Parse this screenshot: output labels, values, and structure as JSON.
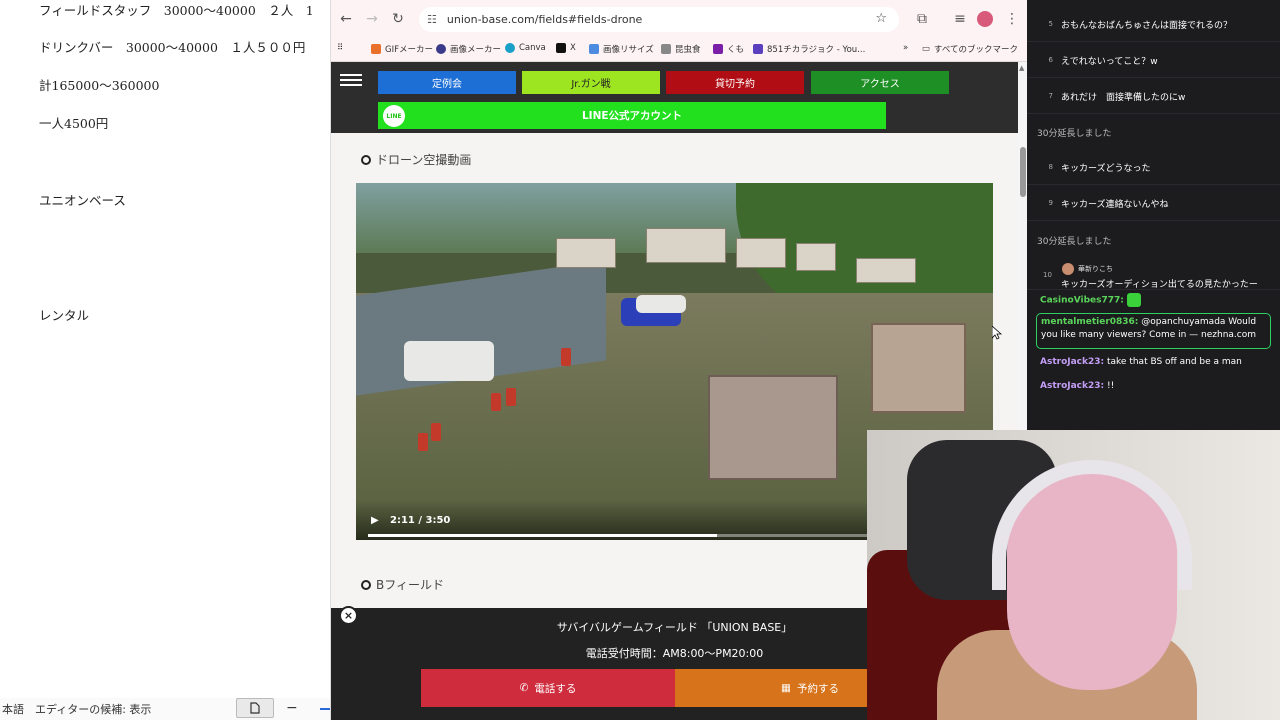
{
  "document": {
    "lines": [
      "フィールドスタッフ　30000〜40000　２人　1",
      "ドリンクバー　30000〜40000　１人５００円",
      "計165000〜360000",
      "一人4500円",
      "ユニオンベース",
      "レンタル"
    ],
    "status": "本語　エディターの候補: 表示"
  },
  "browser": {
    "url": "union-base.com/fields#fields-drone",
    "bookmarks": [
      "GIFメーカー",
      "画像メーカー",
      "Canva",
      "X",
      "画像リサイズ",
      "昆虫食",
      "くも",
      "851チカラジョク - You..."
    ],
    "all_bookmarks": "すべてのブックマーク",
    "colors": {
      "toolbar": "#fdf3f4"
    }
  },
  "site": {
    "nav": [
      {
        "label": "定例会",
        "color": "#1d6fd6"
      },
      {
        "label": "Jr.ガン戦",
        "color": "#9ee521"
      },
      {
        "label": "貸切予約",
        "color": "#b00d14"
      },
      {
        "label": "アクセス",
        "color": "#1d8f24"
      }
    ],
    "line_button": "LINE公式アカウント",
    "line_logo": "LINE",
    "section_drone": "ドローン空撮動画",
    "section_b": "Bフィールド",
    "video": {
      "time": "2:11 / 3:50",
      "progress": 0.57
    },
    "cta": {
      "title": "サバイバルゲームフィールド 「UNION BASE」",
      "hours": "電話受付時間：AM8:00〜PM20:00",
      "call": "電話する",
      "reserve": "予約する"
    }
  },
  "chat": {
    "questions": [
      {
        "n": "5",
        "text": "おもんなおばんちゅさんは面接でれるの？"
      },
      {
        "n": "6",
        "text": "えでれないってこと？w"
      },
      {
        "n": "7",
        "text": "あれだけ　面接準備したのにw"
      }
    ],
    "note1": "30分延長しました",
    "questions2": [
      {
        "n": "8",
        "text": "キッカーズどうなった"
      },
      {
        "n": "9",
        "text": "キッカーズ連絡ないんやね"
      }
    ],
    "note2": "30分延長しました",
    "q10": {
      "n": "10",
      "who": "華新りこち",
      "text": "キッカーズオーディション出てるの見たかったー"
    },
    "messages": [
      {
        "user": "CasinoVibes777:",
        "text": "",
        "color": "#5ad45a"
      },
      {
        "user": "mentalmetier0836:",
        "text": " @opanchuyamada Would you like many viewers? Come in — nezhna.com",
        "color": "#5ad45a"
      },
      {
        "user": "AstroJack23:",
        "text": " take that BS off and be a man",
        "color": "#c39ef5"
      },
      {
        "user": "AstroJack23:",
        "text": " !!",
        "color": "#c39ef5"
      }
    ]
  }
}
